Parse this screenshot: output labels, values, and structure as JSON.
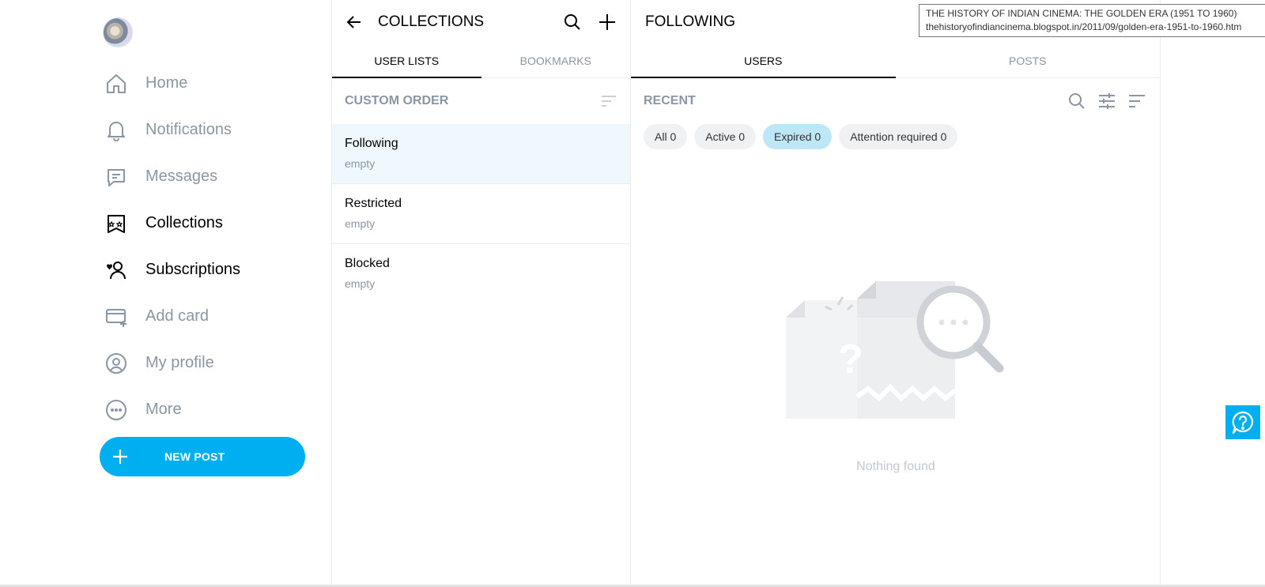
{
  "sidebar": {
    "items": [
      {
        "label": "Home",
        "icon": "home-icon"
      },
      {
        "label": "Notifications",
        "icon": "bell-icon"
      },
      {
        "label": "Messages",
        "icon": "message-icon"
      },
      {
        "label": "Collections",
        "icon": "collections-icon"
      },
      {
        "label": "Subscriptions",
        "icon": "subscriptions-icon"
      },
      {
        "label": "Add card",
        "icon": "add-card-icon"
      },
      {
        "label": "My profile",
        "icon": "profile-icon"
      },
      {
        "label": "More",
        "icon": "more-icon"
      }
    ],
    "new_post_label": "NEW POST"
  },
  "collections": {
    "title": "COLLECTIONS",
    "tabs": [
      "USER LISTS",
      "BOOKMARKS"
    ],
    "sort_label": "CUSTOM ORDER",
    "lists": [
      {
        "name": "Following",
        "status": "empty"
      },
      {
        "name": "Restricted",
        "status": "empty"
      },
      {
        "name": "Blocked",
        "status": "empty"
      }
    ]
  },
  "following": {
    "title": "FOLLOWING",
    "tabs": [
      "USERS",
      "POSTS"
    ],
    "section_label": "RECENT",
    "filters": [
      "All 0",
      "Active 0",
      "Expired 0",
      "Attention required 0"
    ],
    "empty_message": "Nothing found"
  },
  "tooltip": {
    "line1": "THE HISTORY OF INDIAN CINEMA: THE GOLDEN ERA (1951 TO 1960)",
    "line2": "thehistoryofindiancinema.blogspot.in/2011/09/golden-era-1951-to-1960.htm"
  },
  "colors": {
    "accent": "#00aff0",
    "muted_text": "#8a96a3",
    "selected_row": "#eef8fd",
    "active_chip": "#bde7f7"
  }
}
